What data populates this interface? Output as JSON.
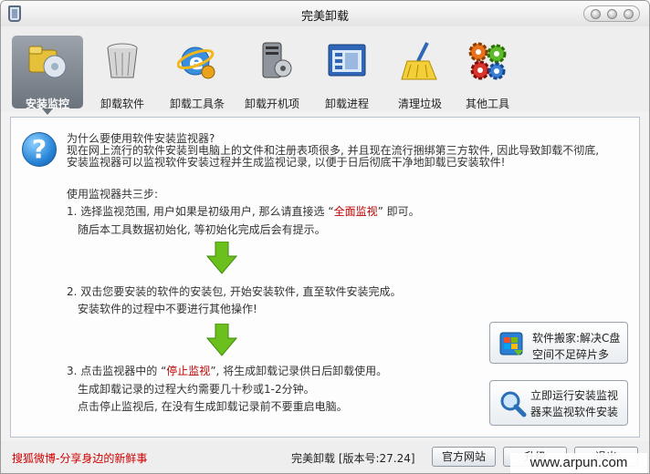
{
  "window": {
    "title": "完美卸载"
  },
  "toolbar": {
    "items": [
      {
        "label": "安装监控",
        "icon": "install-monitor-icon",
        "active": true
      },
      {
        "label": "卸载软件",
        "icon": "trash-bin-icon"
      },
      {
        "label": "卸载工具条",
        "icon": "ie-browser-icon"
      },
      {
        "label": "卸载开机项",
        "icon": "startup-pc-icon"
      },
      {
        "label": "卸载进程",
        "icon": "process-window-icon"
      },
      {
        "label": "清理垃圾",
        "icon": "broom-icon"
      },
      {
        "label": "其他工具",
        "icon": "gears-icon"
      }
    ]
  },
  "intro": {
    "question": "为什么要使用软件安装监视器?",
    "line1": "现在网上流行的软件安装到电脑上的文件和注册表项很多, 并且现在流行捆绑第三方软件, 因此导致卸载不彻底,",
    "line2": "安装监视器可以监视软件安装过程并生成监视记录, 以便于日后彻底干净地卸载已安装软件!"
  },
  "steps": {
    "heading": "使用监视器共三步:",
    "s1_pre": "1. 选择监视范围, 用户如果是初级用户, 那么请直接选 “",
    "s1_hl": "全面监视",
    "s1_post": "” 即可。",
    "s1_sub": "随后本工具数据初始化, 等初始化完成后会有提示。",
    "s2": "2. 双击您要安装的软件的安装包, 开始安装软件, 直至软件安装完成。",
    "s2_sub": "安装软件的过程中不要进行其他操作!",
    "s3_pre": "3. 点击监视器中的 “",
    "s3_hl": "停止监视",
    "s3_post": "”, 将生成卸载记录供日后卸载使用。",
    "s3_sub1": "生成卸载记录的过程大约需要几十秒或1-2分钟。",
    "s3_sub2": "点击停止监视后, 在没有生成卸载记录前不要重启电脑。"
  },
  "side_buttons": {
    "move_line1": "软件搬家:解决C盘",
    "move_line2": "空间不足碎片多",
    "monitor_line1": "立即运行安装监视",
    "monitor_line2": "器来监视软件安装"
  },
  "status": {
    "weibo": "搜狐微博-分享身边的新鲜事",
    "version": "完美卸载 [版本号:27.24]",
    "website": "官方网站",
    "upgrade": "升级",
    "exit": "退出"
  },
  "watermark": "www.arpun.com",
  "colors": {
    "highlight": "#c00000",
    "arrow": "#6cc01e",
    "help": "#2a86d8"
  }
}
